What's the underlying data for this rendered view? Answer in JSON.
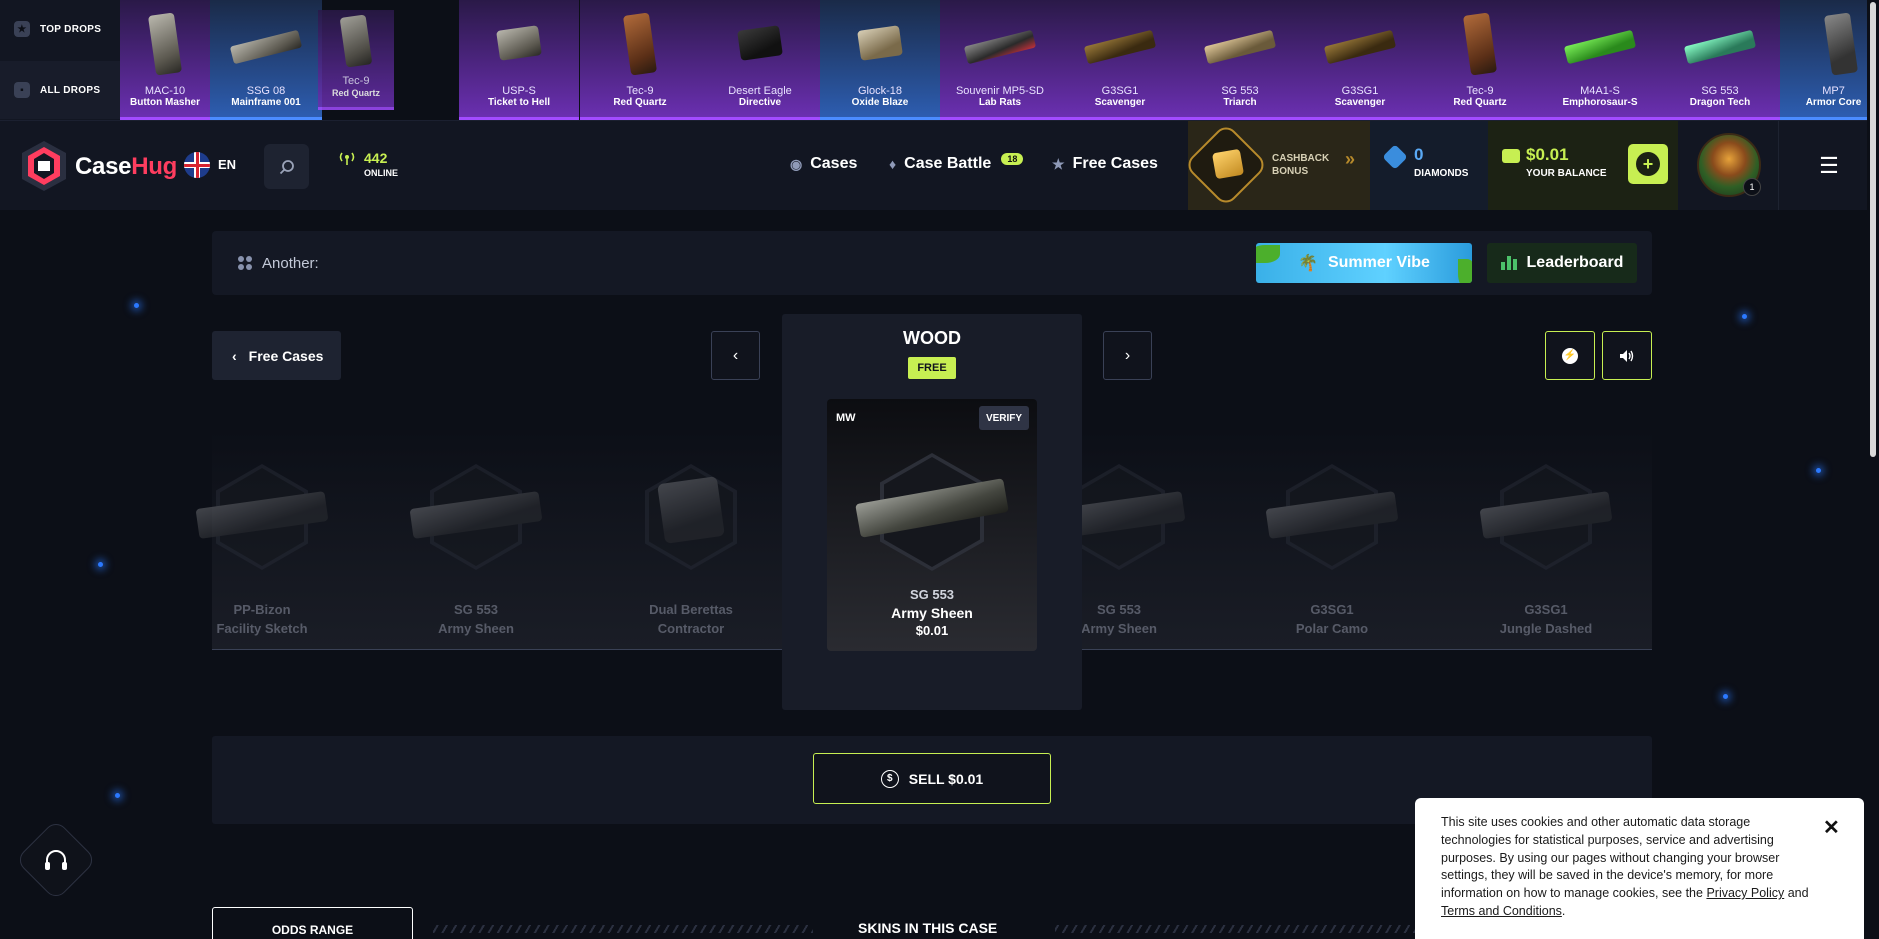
{
  "drops_side": {
    "top_label": "TOP DROPS",
    "all_label": "ALL DROPS"
  },
  "drops": [
    {
      "name": "MAC-10",
      "skin": "Button Masher"
    },
    {
      "name": "SSG 08",
      "skin": "Mainframe 001"
    },
    {
      "name": "Tec-9",
      "skin": "Red Quartz"
    },
    {
      "name": "USP-S",
      "skin": "Ticket to Hell"
    },
    {
      "name": "Tec-9",
      "skin": "Red Quartz"
    },
    {
      "name": "Desert Eagle",
      "skin": "Directive"
    },
    {
      "name": "Glock-18",
      "skin": "Oxide Blaze"
    },
    {
      "name": "Souvenir MP5-SD",
      "skin": "Lab Rats"
    },
    {
      "name": "G3SG1",
      "skin": "Scavenger"
    },
    {
      "name": "SG 553",
      "skin": "Triarch"
    },
    {
      "name": "G3SG1",
      "skin": "Scavenger"
    },
    {
      "name": "Tec-9",
      "skin": "Red Quartz"
    },
    {
      "name": "M4A1-S",
      "skin": "Emphorosaur-S"
    },
    {
      "name": "SG 553",
      "skin": "Dragon Tech"
    },
    {
      "name": "MP7",
      "skin": "Armor Core"
    }
  ],
  "header": {
    "logo_case": "Case",
    "logo_hug": "Hug",
    "lang": "EN",
    "online_count": "442",
    "online_label": "ONLINE",
    "nav_cases": "Cases",
    "nav_battle": "Case Battle",
    "nav_battle_badge": "18",
    "nav_free": "Free Cases",
    "cashback_line1": "CASHBACK",
    "cashback_line2": "BONUS",
    "diamonds_value": "0",
    "diamonds_label": "DIAMONDS",
    "balance_value": "$0.01",
    "balance_label": "YOUR BALANCE",
    "avatar_level": "1"
  },
  "another": {
    "label": "Another:",
    "summer": "Summer Vibe",
    "leaderboard": "Leaderboard"
  },
  "case": {
    "back_label": "Free Cases",
    "title": "WOOD",
    "badge": "FREE"
  },
  "spinner_items": [
    {
      "name": "PP-Bizon",
      "skin": "Facility Sketch"
    },
    {
      "name": "SG 553",
      "skin": "Army Sheen"
    },
    {
      "name": "Dual Berettas",
      "skin": "Contractor"
    },
    {
      "name": "SG 553",
      "skin": "Army Sheen"
    },
    {
      "name": "G3SG1",
      "skin": "Polar Camo"
    },
    {
      "name": "G3SG1",
      "skin": "Jungle Dashed"
    }
  ],
  "won_item": {
    "wear": "MW",
    "verify": "VERIFY",
    "name": "SG 553",
    "skin": "Army Sheen",
    "price": "$0.01"
  },
  "sell": {
    "label": "SELL $0.01",
    "coin": "$"
  },
  "bottom": {
    "odds": "ODDS RANGE",
    "skins_title": "SKINS IN THIS CASE"
  },
  "cookie": {
    "text": "This site uses cookies and other automatic data storage technologies for statistical purposes, service and advertising purposes. By using our pages without changing your browser settings, they will be saved in the device's memory, for more information on how to manage cookies, see the ",
    "privacy": "Privacy Policy",
    "and": " and ",
    "terms": "Terms and Conditions",
    "end": "."
  },
  "colors": {
    "accent": "#c7ef52",
    "brand": "#ff3d5f",
    "drop_purple": "#6a2fb0",
    "drop_blue": "#2d5db0"
  }
}
